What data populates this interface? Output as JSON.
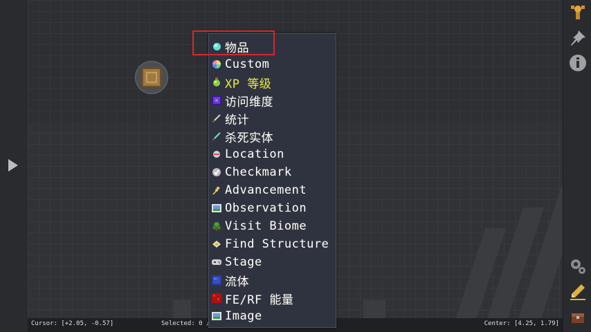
{
  "sidebar_left": {
    "expand_arrow": "arrow-right-icon"
  },
  "menu": {
    "items": [
      {
        "label": "物品",
        "icon": "diamond-icon",
        "color": "#5ce0d8"
      },
      {
        "label": "Custom",
        "icon": "rainbow-orb-icon",
        "color": "#ff7ac8"
      },
      {
        "label": "XP 等级",
        "icon": "xp-bottle-icon",
        "color": "#e8e84a"
      },
      {
        "label": "访问维度",
        "icon": "portal-icon",
        "color": "#5a2fc7"
      },
      {
        "label": "统计",
        "icon": "sword-icon",
        "color": "#cfcfcf"
      },
      {
        "label": "杀死实体",
        "icon": "diamond-sword-icon",
        "color": "#6fe0e0"
      },
      {
        "label": "Location",
        "icon": "compass-icon",
        "color": "#e05050"
      },
      {
        "label": "Checkmark",
        "icon": "checkmark-icon",
        "color": "#bdbdbd"
      },
      {
        "label": "Advancement",
        "icon": "wheat-icon",
        "color": "#e0b040"
      },
      {
        "label": "Observation",
        "icon": "painting-icon",
        "color": "#5fa0e0"
      },
      {
        "label": "Visit Biome",
        "icon": "sapling-icon",
        "color": "#4a9a3a"
      },
      {
        "label": "Find Structure",
        "icon": "map-icon",
        "color": "#f0e0a0"
      },
      {
        "label": "Stage",
        "icon": "gamepad-icon",
        "color": "#cfcfcf"
      },
      {
        "label": "流体",
        "icon": "water-icon",
        "color": "#3b4fc4"
      },
      {
        "label": "FE/RF 能量",
        "icon": "redstone-block-icon",
        "color": "#b01010"
      },
      {
        "label": "Image",
        "icon": "image-icon",
        "color": "#5fa0e0"
      }
    ]
  },
  "status": {
    "cursor": "Cursor: [+2.05, -0.57]",
    "selected": "Selected: 0 /",
    "center": "Center: [4.25, 1.79]"
  },
  "toolbar_right": {
    "top": [
      "quest-book-icon",
      "pin-icon",
      "info-icon"
    ],
    "bottom": [
      "settings-gear-icon",
      "pencil-icon",
      "chest-icon"
    ]
  }
}
